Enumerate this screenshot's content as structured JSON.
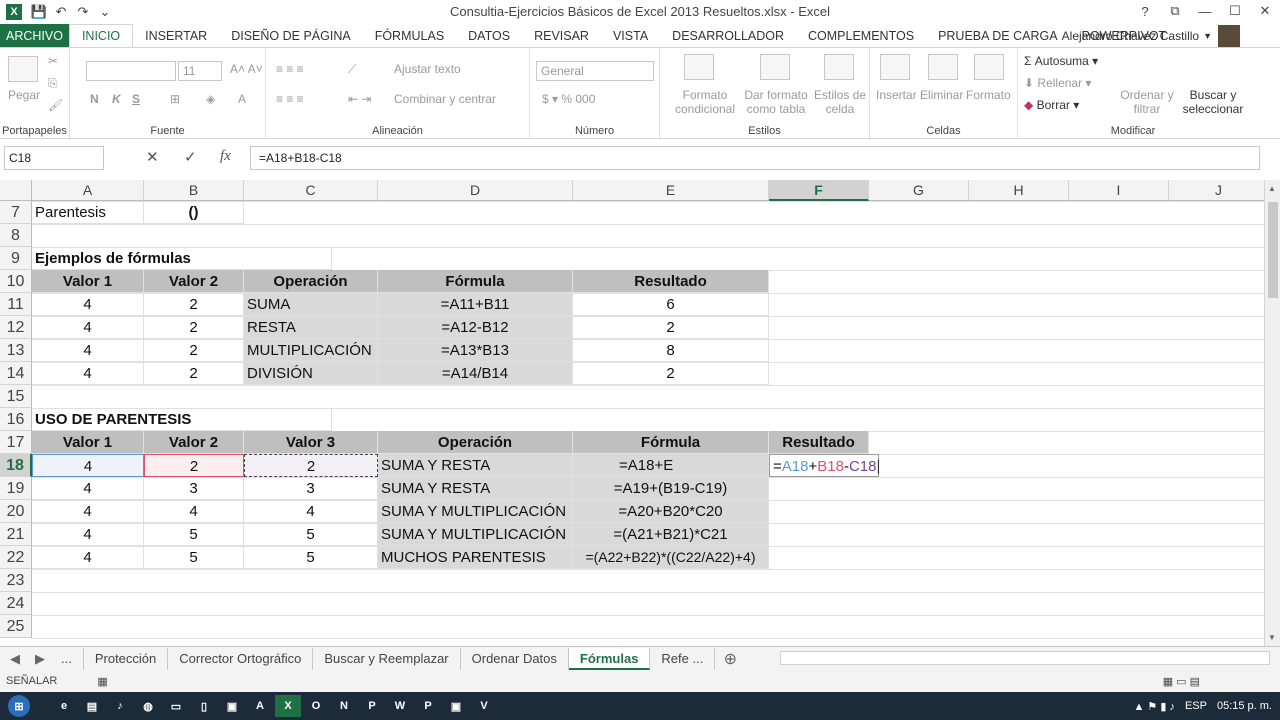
{
  "window": {
    "title": "Consultia-Ejercicios Básicos de Excel 2013 Resueltos.xlsx - Excel",
    "user": "Alejandro Chavez Castillo"
  },
  "menu": [
    "ARCHIVO",
    "INICIO",
    "INSERTAR",
    "DISEÑO DE PÁGINA",
    "FÓRMULAS",
    "DATOS",
    "REVISAR",
    "VISTA",
    "DESARROLLADOR",
    "COMPLEMENTOS",
    "PRUEBA DE CARGA",
    "POWERPIVOT"
  ],
  "ribbon": {
    "portapapeles": {
      "paste": "Pegar",
      "label": "Portapapeles"
    },
    "fuente": {
      "size": "11",
      "label": "Fuente",
      "bold": "N",
      "italic": "K",
      "underline": "S"
    },
    "alineacion": {
      "wrap": "Ajustar texto",
      "merge": "Combinar y centrar",
      "label": "Alineación"
    },
    "numero": {
      "format": "General",
      "label": "Número"
    },
    "estilos": {
      "cond": "Formato condicional",
      "table": "Dar formato como tabla",
      "cell": "Estilos de celda",
      "label": "Estilos"
    },
    "celdas": {
      "insert": "Insertar",
      "delete": "Eliminar",
      "format": "Formato",
      "label": "Celdas"
    },
    "modificar": {
      "autosum": "Autosuma",
      "fill": "Rellenar",
      "clear": "Borrar",
      "sort": "Ordenar y filtrar",
      "find": "Buscar y seleccionar",
      "label": "Modificar"
    }
  },
  "formula_bar": {
    "name_box": "C18",
    "formula": "=A18+B18-C18"
  },
  "columns": [
    "A",
    "B",
    "C",
    "D",
    "E",
    "F",
    "G",
    "H",
    "I",
    "J"
  ],
  "rows": [
    "7",
    "8",
    "9",
    "10",
    "11",
    "12",
    "13",
    "14",
    "15",
    "16",
    "17",
    "18",
    "19",
    "20",
    "21",
    "22",
    "23",
    "24",
    "25"
  ],
  "cells": {
    "r7": {
      "a": "Parentesis",
      "b": "()"
    },
    "r9": {
      "a": "Ejemplos de fórmulas"
    },
    "r10": {
      "a": "Valor 1",
      "b": "Valor 2",
      "c": "Operación",
      "d": "Fórmula",
      "e": "Resultado"
    },
    "r11": {
      "a": "4",
      "b": "2",
      "c": "SUMA",
      "d": "=A11+B11",
      "e": "6"
    },
    "r12": {
      "a": "4",
      "b": "2",
      "c": "RESTA",
      "d": "=A12-B12",
      "e": "2"
    },
    "r13": {
      "a": "4",
      "b": "2",
      "c": "MULTIPLICACIÓN",
      "d": "=A13*B13",
      "e": "8"
    },
    "r14": {
      "a": "4",
      "b": "2",
      "c": "DIVISIÓN",
      "d": "=A14/B14",
      "e": "2"
    },
    "r16": {
      "a": "USO DE PARENTESIS"
    },
    "r17": {
      "a": "Valor 1",
      "b": "Valor 2",
      "c": "Valor 3",
      "d": "Operación",
      "e": "Fórmula",
      "f": "Resultado"
    },
    "r18": {
      "a": "4",
      "b": "2",
      "c": "2",
      "d": "SUMA Y RESTA",
      "e": "=A18+E",
      "f_eq": "=",
      "f_a": "A18",
      "f_plus": "+",
      "f_b": "B18",
      "f_minus": "-",
      "f_c": "C18"
    },
    "r19": {
      "a": "4",
      "b": "3",
      "c": "3",
      "d": "SUMA Y RESTA",
      "e": "=A19+(B19-C19)"
    },
    "r20": {
      "a": "4",
      "b": "4",
      "c": "4",
      "d": "SUMA Y MULTIPLICACIÓN",
      "e": "=A20+B20*C20"
    },
    "r21": {
      "a": "4",
      "b": "5",
      "c": "5",
      "d": "SUMA Y MULTIPLICACIÓN",
      "e": "=(A21+B21)*C21"
    },
    "r22": {
      "a": "4",
      "b": "5",
      "c": "5",
      "d": "MUCHOS PARENTESIS",
      "e": "=(A22+B22)*((C22/A22)+4)"
    }
  },
  "sheets": [
    "...",
    "Protección",
    "Corrector Ortográfico",
    "Buscar y Reemplazar",
    "Ordenar Datos",
    "Fórmulas",
    "Refe ..."
  ],
  "status": {
    "mode": "SEÑALAR"
  },
  "taskbar": {
    "lang": "ESP",
    "clock": "05:15 p. m."
  },
  "colors": {
    "accent": "#1e7145",
    "ref_a": "#5b9bd5",
    "ref_b": "#e0506a",
    "ref_c": "#7a3f9a"
  }
}
